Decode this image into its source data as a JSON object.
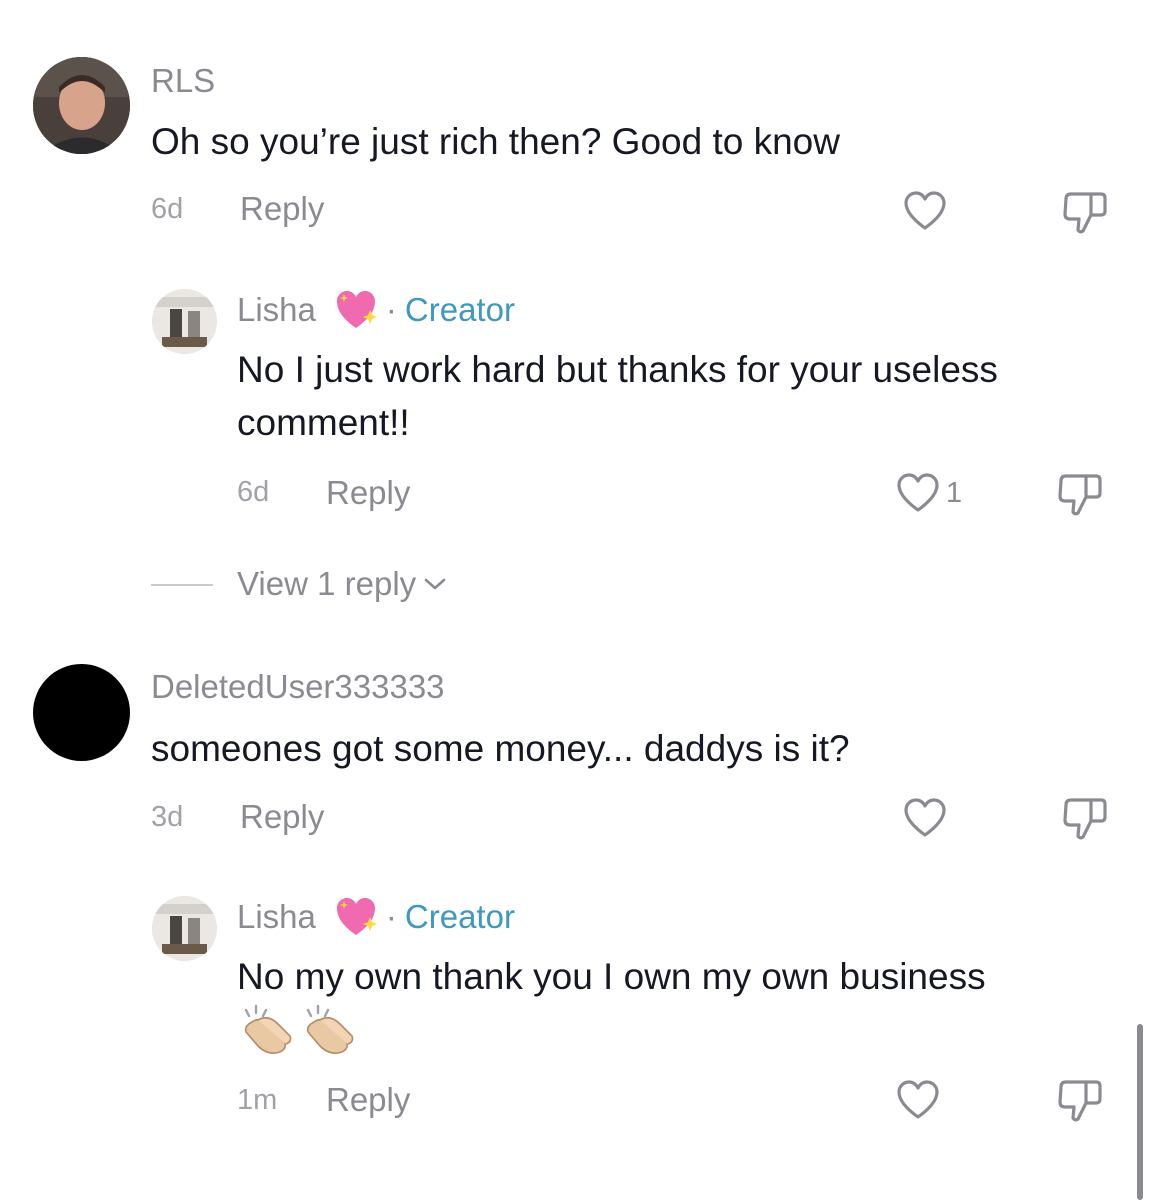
{
  "comments": [
    {
      "username": "RLS",
      "text": "Oh so you’re just rich then? Good to know",
      "time": "6d",
      "reply_label": "Reply",
      "like_icon": "heart-outline-icon",
      "dislike_icon": "thumbs-down-icon",
      "reply": {
        "username": "Lisha",
        "badge_emoji": "sparkling-heart-icon",
        "badge_label": "Creator",
        "dot": "·",
        "text": "No I just work hard but thanks for your useless comment!!",
        "time": "6d",
        "reply_label": "Reply",
        "like_count": "1"
      },
      "view_replies_label": "View 1 reply"
    },
    {
      "username": "DeletedUser333333",
      "text": "someones got some money... daddys is it?",
      "time": "3d",
      "reply_label": "Reply",
      "reply": {
        "username": "Lisha",
        "badge_label": "Creator",
        "dot": "·",
        "text": "No my own thank you I own my own business",
        "emoji": [
          "clapping-hands-icon",
          "clapping-hands-icon"
        ],
        "time": "1m",
        "reply_label": "Reply"
      }
    }
  ],
  "colors": {
    "text": "#161823",
    "secondary": "#8a8b91",
    "creator": "#3e98bf",
    "heart_emoji": "#f06ab0"
  }
}
